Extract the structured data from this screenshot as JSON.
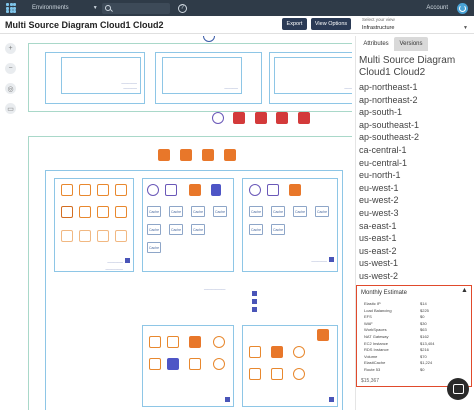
{
  "topbar": {
    "environments_label": "Environments",
    "account_label": "Account"
  },
  "header": {
    "title": "Multi Source Diagram Cloud1 Cloud2",
    "export_label": "Export",
    "view_options_label": "View Options",
    "view_select_label": "Select your view",
    "view_select_value": "Infrastructure"
  },
  "tools": {
    "zoom_in": "+",
    "zoom_out": "−"
  },
  "canvas": {
    "cache_label": "Cache"
  },
  "panel": {
    "tabs": [
      "Attributes",
      "Versions"
    ],
    "title": "Multi Source Diagram Cloud1 Cloud2",
    "regions": [
      "ap-northeast-1",
      "ap-northeast-2",
      "ap-south-1",
      "ap-southeast-1",
      "ap-southeast-2",
      "ca-central-1",
      "eu-central-1",
      "eu-north-1",
      "eu-west-1",
      "eu-west-2",
      "eu-west-3",
      "sa-east-1",
      "us-east-1",
      "us-east-2",
      "us-west-1",
      "us-west-2"
    ],
    "estimate": {
      "title": "Monthly Estimate",
      "rows": [
        {
          "name": "Elastic IP",
          "value": "$14"
        },
        {
          "name": "Load Balancing",
          "value": "$225"
        },
        {
          "name": "EFS",
          "value": "$0"
        },
        {
          "name": "WAF",
          "value": "$30"
        },
        {
          "name": "WorkSpaces",
          "value": "$63"
        },
        {
          "name": "NAT Gateway",
          "value": "$162"
        },
        {
          "name": "EC2 Instance",
          "value": "$13,404"
        },
        {
          "name": "RDS Instance",
          "value": "$216"
        },
        {
          "name": "Volume",
          "value": "$70"
        },
        {
          "name": "ElastiCache",
          "value": "$1,224"
        },
        {
          "name": "Route 53",
          "value": "$0"
        }
      ],
      "total": "$15,367"
    }
  },
  "colors": {
    "nav": "#2f3b48",
    "button": "#2b3a55",
    "estimate_border": "#e04a2c"
  }
}
